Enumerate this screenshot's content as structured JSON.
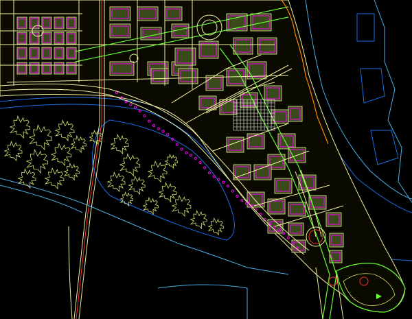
{
  "drawing": {
    "background": "#000000",
    "colors": {
      "parcel_outline": "#ff00ff",
      "road_line": "#f0f0a0",
      "block_fill": "#3a4a1a",
      "green_line": "#66ff33",
      "tree_outline": "#d8e070",
      "river_bank": "#1a6ee6",
      "river_bank_light": "#4ab0e8",
      "cyan_line": "#33cccc",
      "red_line": "#ff3333",
      "white_line": "#ffffff",
      "orange_line": "#ff8800"
    }
  }
}
